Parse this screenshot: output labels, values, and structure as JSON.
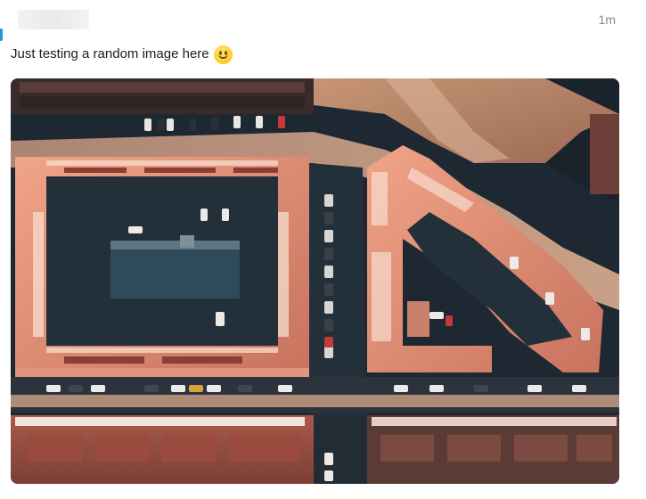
{
  "message": {
    "timestamp": "1m",
    "text": "Just testing a random image here",
    "emoji": "smile-emoji-icon"
  },
  "attachment": {
    "type": "image",
    "subject": "aerial-city-blocks-photo"
  },
  "colors": {
    "accent": "#1d9bd1",
    "timestamp": "#8a8a8e",
    "text": "#1d1c1d"
  }
}
